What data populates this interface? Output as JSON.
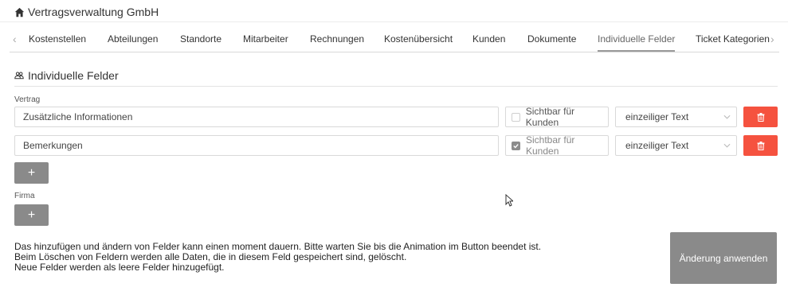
{
  "header": {
    "title": "Vertragsverwaltung GmbH",
    "icon": "home-icon"
  },
  "tabs": [
    {
      "label": "Kostenstellen"
    },
    {
      "label": "Abteilungen"
    },
    {
      "label": "Standorte"
    },
    {
      "label": "Mitarbeiter"
    },
    {
      "label": "Rechnungen"
    },
    {
      "label": "Kostenübersicht"
    },
    {
      "label": "Kunden"
    },
    {
      "label": "Dokumente"
    },
    {
      "label": "Individuelle Felder",
      "active": true
    },
    {
      "label": "Ticket Kategorien"
    }
  ],
  "section": {
    "title": "Individuelle Felder",
    "icon": "users-icon"
  },
  "vertrag": {
    "label": "Vertrag",
    "fields": [
      {
        "name": "Zusätzliche Informationen",
        "visible_label": "Sichtbar für Kunden",
        "visible": false,
        "type": "einzeiliger Text"
      },
      {
        "name": "Bemerkungen",
        "visible_label": "Sichtbar für Kunden",
        "visible": true,
        "type": "einzeiliger Text"
      }
    ],
    "add_label": "+"
  },
  "firma": {
    "label": "Firma",
    "add_label": "+"
  },
  "info": {
    "line1": "Das hinzufügen und ändern von Felder kann einen moment dauern. Bitte warten Sie bis die Animation im Button beendet ist.",
    "line2": "Beim Löschen von Feldern werden alle Daten, die in diesem Feld gespeichert sind, gelöscht.",
    "line3": "Neue Felder werden als leere Felder hinzugefügt."
  },
  "apply_label": "Änderung anwenden",
  "colors": {
    "delete": "#f5523f",
    "button_gray": "#8a8a8a"
  }
}
